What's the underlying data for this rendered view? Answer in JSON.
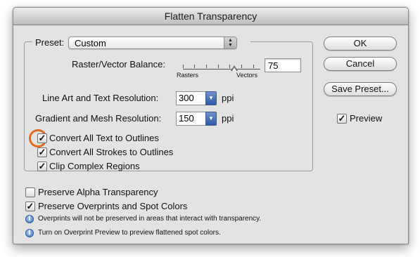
{
  "window": {
    "title": "Flatten Transparency"
  },
  "preset": {
    "label": "Preset:",
    "value": "Custom"
  },
  "balance": {
    "label": "Raster/Vector Balance:",
    "value": "75",
    "min_label": "Rasters",
    "max_label": "Vectors"
  },
  "line_art": {
    "label": "Line Art and Text Resolution:",
    "value": "300",
    "unit": "ppi"
  },
  "gradient": {
    "label": "Gradient and Mesh Resolution:",
    "value": "150",
    "unit": "ppi"
  },
  "options": {
    "convert_text": {
      "label": "Convert All Text to Outlines",
      "checked": true
    },
    "convert_strokes": {
      "label": "Convert All Strokes to Outlines",
      "checked": true
    },
    "clip_regions": {
      "label": "Clip Complex Regions",
      "checked": true
    }
  },
  "preserve_alpha": {
    "label": "Preserve Alpha Transparency",
    "checked": false
  },
  "preserve_overprints": {
    "label": "Preserve Overprints and Spot Colors",
    "checked": true
  },
  "notes": {
    "note1": "Overprints will not be preserved in areas that interact with transparency.",
    "note2": "Turn on Overprint Preview to preview flattened spot colors."
  },
  "buttons": {
    "ok": "OK",
    "cancel": "Cancel",
    "save_preset": "Save Preset..."
  },
  "preview": {
    "label": "Preview",
    "checked": true
  },
  "colors": {
    "highlight": "#e3691b",
    "combo_accent": "#2f5ca8"
  }
}
